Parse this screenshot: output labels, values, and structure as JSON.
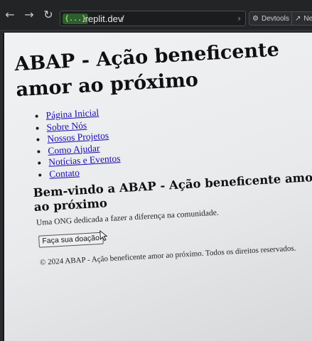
{
  "browser": {
    "back_icon": "arrow-left-icon",
    "forward_icon": "arrow-right-icon",
    "reload_icon": "reload-icon",
    "url_badge": "{...}",
    "url_domain": ".replit.dev",
    "url_path": "/",
    "go_icon": "arrow-right-icon",
    "devtools_label": "Devtools",
    "new_tab_label": "Nev"
  },
  "page": {
    "title": "ABAP - Ação beneficente amor ao próximo",
    "nav": [
      {
        "label": "Página Inicial"
      },
      {
        "label": "Sobre Nós"
      },
      {
        "label": "Nossos Projetos"
      },
      {
        "label": "Como Ajudar"
      },
      {
        "label": "Notícias e Eventos"
      },
      {
        "label": "Contato"
      }
    ],
    "welcome_heading": "Bem-vindo a ABAP - Ação beneficente amor ao próximo",
    "description": "Uma ONG dedicada a fazer a diferença na comunidade.",
    "donate_button": "Faça sua doação",
    "footer": "© 2024 ABAP - Ação beneficente amor ao próximo. Todos os direitos reservados."
  }
}
